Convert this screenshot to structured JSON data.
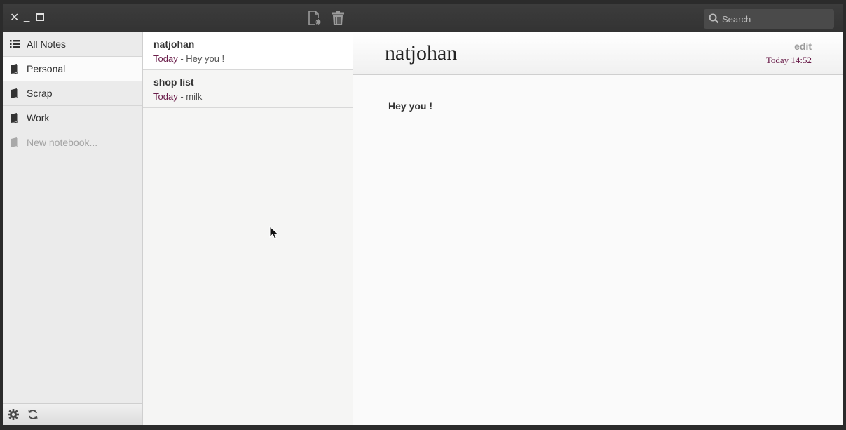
{
  "window": {
    "controls": {
      "close": "✕",
      "minimize": "_",
      "maximize": "▭"
    }
  },
  "toolbar": {
    "new_note_icon": "new-note-icon",
    "delete_icon": "trash-icon"
  },
  "search": {
    "placeholder": "Search"
  },
  "sidebar": {
    "items": [
      {
        "label": "All Notes",
        "icon": "list-icon"
      },
      {
        "label": "Personal",
        "icon": "notebook-icon"
      },
      {
        "label": "Scrap",
        "icon": "notebook-icon"
      },
      {
        "label": "Work",
        "icon": "notebook-icon"
      }
    ],
    "new_notebook": "New notebook...",
    "footer": {
      "settings_icon": "gear-icon",
      "sync_icon": "sync-icon"
    }
  },
  "notes": [
    {
      "title": "natjohan",
      "date": "Today",
      "preview": " - Hey you !"
    },
    {
      "title": "shop list",
      "date": "Today",
      "preview": " - milk"
    }
  ],
  "note_view": {
    "title": "natjohan",
    "edit_label": "edit",
    "date": "Today 14:52",
    "body": "Hey you !"
  },
  "colors": {
    "accent_date": "#6a1d4a",
    "topbar": "#383838",
    "sidebar_bg": "#ebebeb"
  }
}
